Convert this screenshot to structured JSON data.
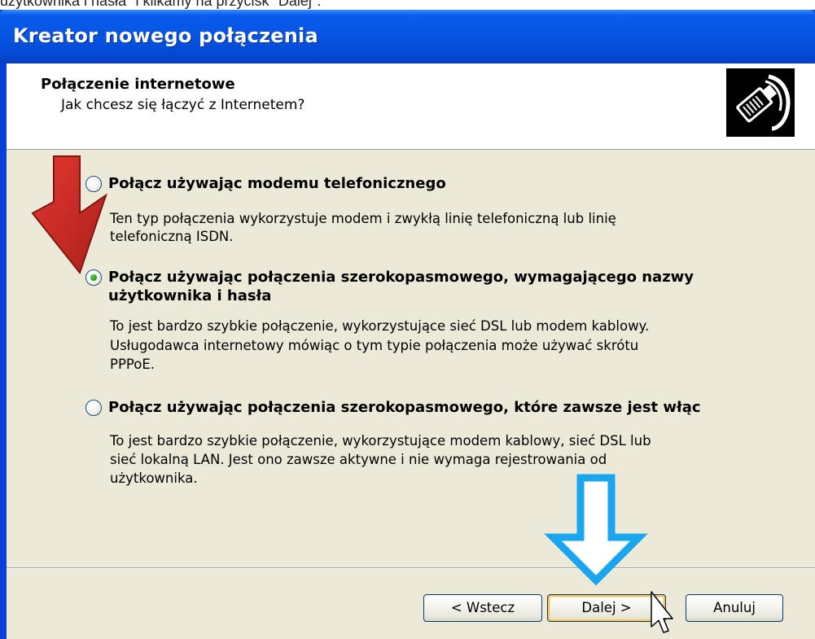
{
  "caption": "użytkownika i hasła\" i klikamy na przycisk \"Dalej\".",
  "window": {
    "title": "Kreator nowego połączenia"
  },
  "header": {
    "title": "Połączenie internetowe",
    "subtitle": "Jak chcesz się łączyć z Internetem?",
    "icon": "network-cable-icon"
  },
  "options": [
    {
      "label_lines": [
        "Połącz używając modemu telefonicznego"
      ],
      "description_lines": [
        "Ten typ połączenia wykorzystuje modem i zwykłą linię telefoniczną lub linię",
        "telefoniczną ISDN."
      ],
      "selected": false
    },
    {
      "label_lines": [
        "Połącz używając połączenia szerokopasmowego, wymagającego nazwy",
        "użytkownika i hasła"
      ],
      "description_lines": [
        "To jest bardzo szybkie połączenie, wykorzystujące sieć DSL lub modem kablowy.",
        "Usługodawca internetowy mówiąc o tym typie połączenia może używać skrótu",
        "PPPoE."
      ],
      "selected": true
    },
    {
      "label_lines": [
        "Połącz używając połączenia szerokopasmowego, które zawsze jest włąc"
      ],
      "description_lines": [
        "To jest bardzo szybkie połączenie, wykorzystujące modem kablowy, sieć DSL lub",
        "sieć lokalną LAN. Jest ono zawsze aktywne i nie wymaga rejestrowania od",
        "użytkownika."
      ],
      "selected": false
    }
  ],
  "buttons": {
    "back": "< Wstecz",
    "next": "Dalej >",
    "cancel": "Anuluj"
  },
  "colors": {
    "title_bar": "#0553e0",
    "client_background": "#ece9d8",
    "red_arrow": "#c8140f",
    "blue_arrow": "#1aa6ee"
  },
  "annotations": {
    "red_arrow_icon": "red-down-right-arrow-icon",
    "blue_arrow_icon": "blue-down-arrow-icon",
    "cursor_icon": "mouse-pointer-icon"
  }
}
